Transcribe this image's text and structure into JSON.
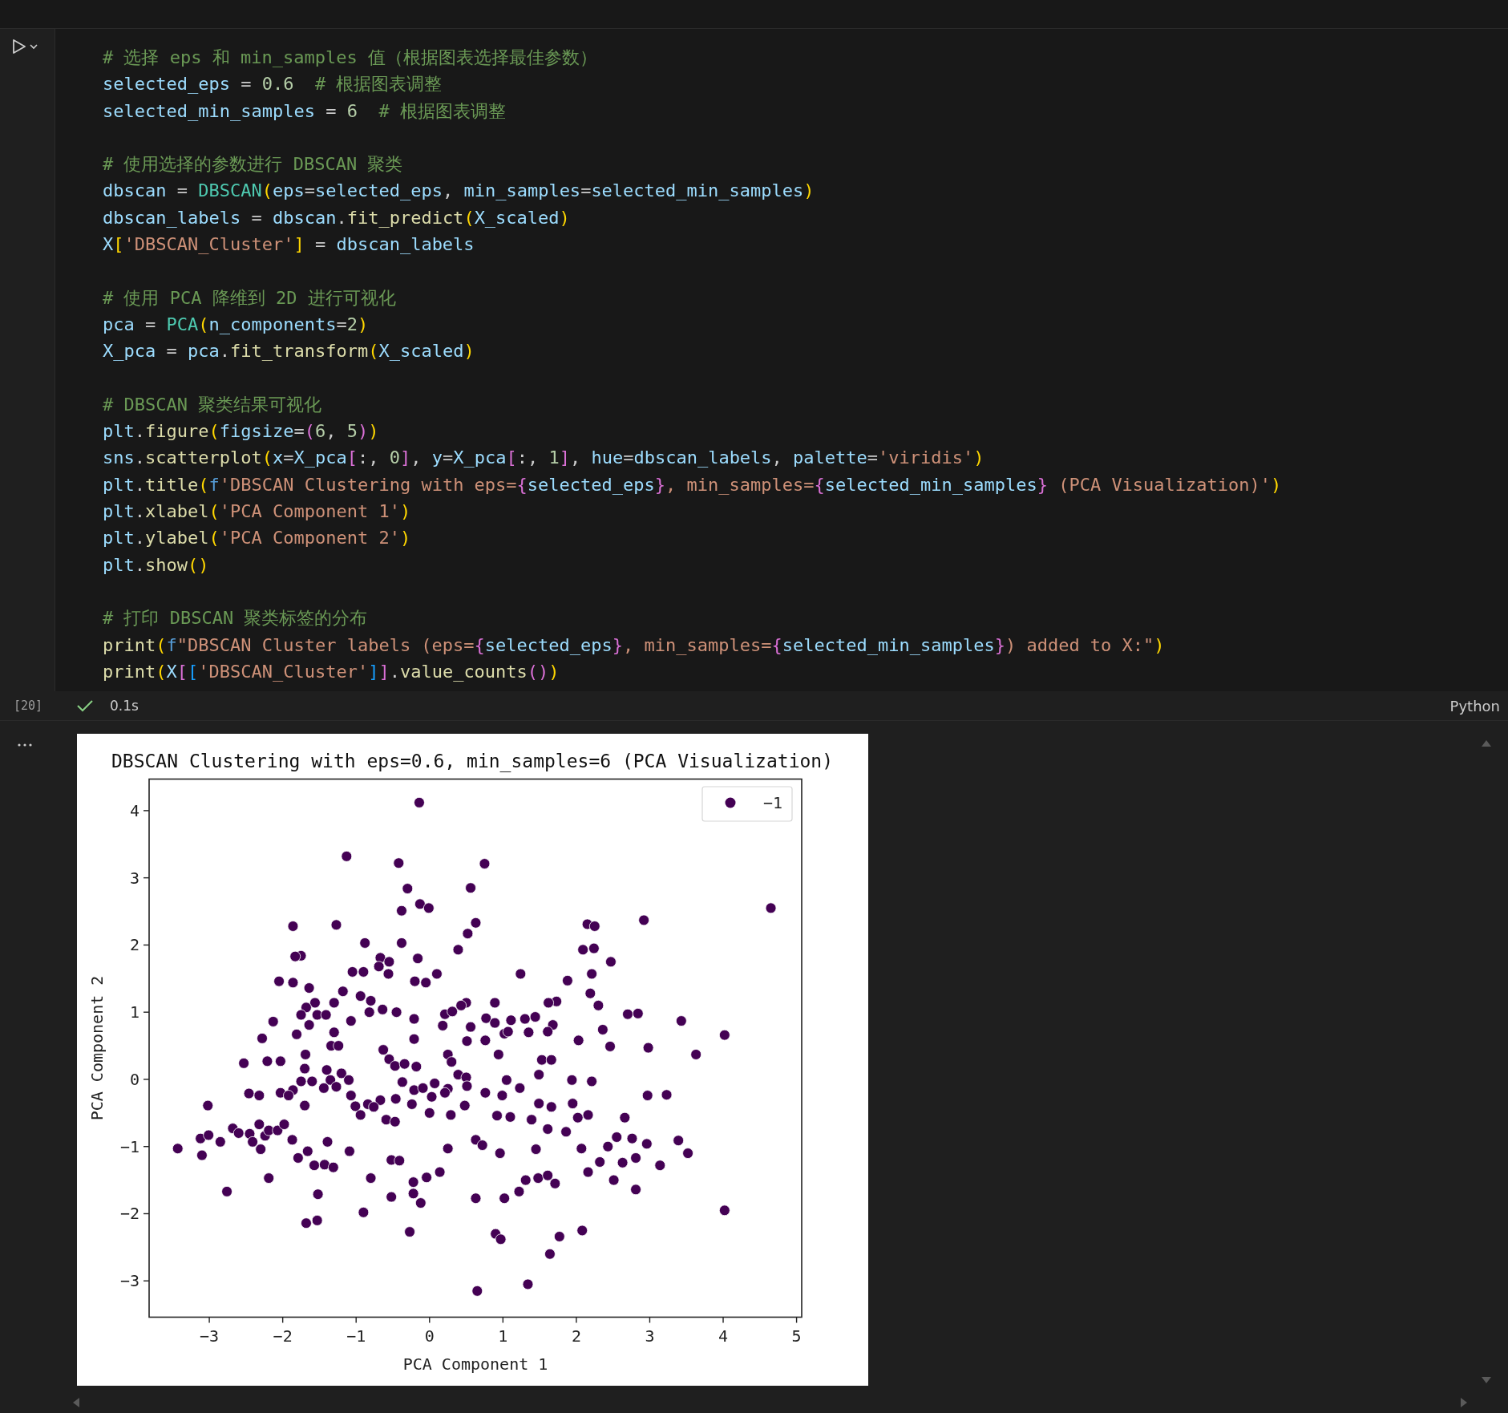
{
  "code_blocks": [
    [
      {
        "tokens": [
          {
            "kind": "comment",
            "text": "# 选择 eps 和 min_samples 值（根据图表选择最佳参数）"
          }
        ]
      },
      {
        "tokens": [
          {
            "kind": "var",
            "text": "selected_eps"
          },
          {
            "kind": "op",
            "text": " = "
          },
          {
            "kind": "num",
            "text": "0.6"
          },
          {
            "kind": "comment",
            "text": "# 根据图表调整"
          }
        ]
      },
      {
        "tokens": [
          {
            "kind": "var",
            "text": "selected_min_samples"
          },
          {
            "kind": "op",
            "text": " = "
          },
          {
            "kind": "num",
            "text": "6"
          },
          {
            "kind": "comment",
            "text": "# 根据图表调整"
          }
        ]
      }
    ],
    [
      {
        "tokens": [
          {
            "kind": "comment",
            "text": "# 使用选择的参数进行 DBSCAN 聚类"
          }
        ]
      },
      {
        "tokens": [
          {
            "kind": "var",
            "text": "dbscan"
          },
          {
            "kind": "op",
            "text": " = "
          },
          {
            "kind": "cls",
            "text": "DBSCAN"
          },
          {
            "kind": "b1",
            "text": "("
          },
          {
            "kind": "var",
            "text": "eps"
          },
          {
            "kind": "op",
            "text": "="
          },
          {
            "kind": "var",
            "text": "selected_eps"
          },
          {
            "kind": "op",
            "text": ", "
          },
          {
            "kind": "var",
            "text": "min_samples"
          },
          {
            "kind": "op",
            "text": "="
          },
          {
            "kind": "var",
            "text": "selected_min_samples"
          },
          {
            "kind": "b1",
            "text": ")"
          }
        ]
      },
      {
        "tokens": [
          {
            "kind": "var",
            "text": "dbscan_labels"
          },
          {
            "kind": "op",
            "text": " = "
          },
          {
            "kind": "var",
            "text": "dbscan"
          },
          {
            "kind": "op",
            "text": "."
          },
          {
            "kind": "fn",
            "text": "fit_predict"
          },
          {
            "kind": "b1",
            "text": "("
          },
          {
            "kind": "var",
            "text": "X_scaled"
          },
          {
            "kind": "b1",
            "text": ")"
          }
        ]
      },
      {
        "tokens": [
          {
            "kind": "var",
            "text": "X"
          },
          {
            "kind": "b1",
            "text": "["
          },
          {
            "kind": "str",
            "text": "'DBSCAN_Cluster'"
          },
          {
            "kind": "b1",
            "text": "]"
          },
          {
            "kind": "op",
            "text": " = "
          },
          {
            "kind": "var",
            "text": "dbscan_labels"
          }
        ]
      }
    ],
    [
      {
        "tokens": [
          {
            "kind": "comment",
            "text": "# 使用 PCA 降维到 2D 进行可视化"
          }
        ]
      },
      {
        "tokens": [
          {
            "kind": "var",
            "text": "pca"
          },
          {
            "kind": "op",
            "text": " = "
          },
          {
            "kind": "cls",
            "text": "PCA"
          },
          {
            "kind": "b1",
            "text": "("
          },
          {
            "kind": "var",
            "text": "n_components"
          },
          {
            "kind": "op",
            "text": "="
          },
          {
            "kind": "num",
            "text": "2"
          },
          {
            "kind": "b1",
            "text": ")"
          }
        ]
      },
      {
        "tokens": [
          {
            "kind": "var",
            "text": "X_pca"
          },
          {
            "kind": "op",
            "text": " = "
          },
          {
            "kind": "var",
            "text": "pca"
          },
          {
            "kind": "op",
            "text": "."
          },
          {
            "kind": "fn",
            "text": "fit_transform"
          },
          {
            "kind": "b1",
            "text": "("
          },
          {
            "kind": "var",
            "text": "X_scaled"
          },
          {
            "kind": "b1",
            "text": ")"
          }
        ]
      }
    ],
    [
      {
        "tokens": [
          {
            "kind": "comment",
            "text": "# DBSCAN 聚类结果可视化"
          }
        ]
      },
      {
        "tokens": [
          {
            "kind": "var",
            "text": "plt"
          },
          {
            "kind": "op",
            "text": "."
          },
          {
            "kind": "fn",
            "text": "figure"
          },
          {
            "kind": "b1",
            "text": "("
          },
          {
            "kind": "var",
            "text": "figsize"
          },
          {
            "kind": "op",
            "text": "="
          },
          {
            "kind": "b2",
            "text": "("
          },
          {
            "kind": "num",
            "text": "6"
          },
          {
            "kind": "op",
            "text": ", "
          },
          {
            "kind": "num",
            "text": "5"
          },
          {
            "kind": "b2",
            "text": ")"
          },
          {
            "kind": "b1",
            "text": ")"
          }
        ]
      },
      {
        "tokens": [
          {
            "kind": "var",
            "text": "sns"
          },
          {
            "kind": "op",
            "text": "."
          },
          {
            "kind": "fn",
            "text": "scatterplot"
          },
          {
            "kind": "b1",
            "text": "("
          },
          {
            "kind": "var",
            "text": "x"
          },
          {
            "kind": "op",
            "text": "="
          },
          {
            "kind": "var",
            "text": "X_pca"
          },
          {
            "kind": "b2",
            "text": "["
          },
          {
            "kind": "op",
            "text": ":, "
          },
          {
            "kind": "num",
            "text": "0"
          },
          {
            "kind": "b2",
            "text": "]"
          },
          {
            "kind": "op",
            "text": ", "
          },
          {
            "kind": "var",
            "text": "y"
          },
          {
            "kind": "op",
            "text": "="
          },
          {
            "kind": "var",
            "text": "X_pca"
          },
          {
            "kind": "b2",
            "text": "["
          },
          {
            "kind": "op",
            "text": ":, "
          },
          {
            "kind": "num",
            "text": "1"
          },
          {
            "kind": "b2",
            "text": "]"
          },
          {
            "kind": "op",
            "text": ", "
          },
          {
            "kind": "var",
            "text": "hue"
          },
          {
            "kind": "op",
            "text": "="
          },
          {
            "kind": "var",
            "text": "dbscan_labels"
          },
          {
            "kind": "op",
            "text": ", "
          },
          {
            "kind": "var",
            "text": "palette"
          },
          {
            "kind": "op",
            "text": "="
          },
          {
            "kind": "str",
            "text": "'viridis'"
          },
          {
            "kind": "b1",
            "text": ")"
          }
        ]
      },
      {
        "tokens": [
          {
            "kind": "var",
            "text": "plt"
          },
          {
            "kind": "op",
            "text": "."
          },
          {
            "kind": "fn",
            "text": "title"
          },
          {
            "kind": "b1",
            "text": "("
          },
          {
            "kind": "kw",
            "text": "f"
          },
          {
            "kind": "str",
            "text": "'DBSCAN Clustering with eps="
          },
          {
            "kind": "b2",
            "text": "{"
          },
          {
            "kind": "var",
            "text": "selected_eps"
          },
          {
            "kind": "b2",
            "text": "}"
          },
          {
            "kind": "str",
            "text": ", min_samples="
          },
          {
            "kind": "b2",
            "text": "{"
          },
          {
            "kind": "var",
            "text": "selected_min_samples"
          },
          {
            "kind": "b2",
            "text": "}"
          },
          {
            "kind": "str",
            "text": " (PCA Visualization)'"
          },
          {
            "kind": "b1",
            "text": ")"
          }
        ]
      },
      {
        "tokens": [
          {
            "kind": "var",
            "text": "plt"
          },
          {
            "kind": "op",
            "text": "."
          },
          {
            "kind": "fn",
            "text": "xlabel"
          },
          {
            "kind": "b1",
            "text": "("
          },
          {
            "kind": "str",
            "text": "'PCA Component 1'"
          },
          {
            "kind": "b1",
            "text": ")"
          }
        ]
      },
      {
        "tokens": [
          {
            "kind": "var",
            "text": "plt"
          },
          {
            "kind": "op",
            "text": "."
          },
          {
            "kind": "fn",
            "text": "ylabel"
          },
          {
            "kind": "b1",
            "text": "("
          },
          {
            "kind": "str",
            "text": "'PCA Component 2'"
          },
          {
            "kind": "b1",
            "text": ")"
          }
        ]
      },
      {
        "tokens": [
          {
            "kind": "var",
            "text": "plt"
          },
          {
            "kind": "op",
            "text": "."
          },
          {
            "kind": "fn",
            "text": "show"
          },
          {
            "kind": "b1",
            "text": "("
          },
          {
            "kind": "b1",
            "text": ")"
          }
        ]
      }
    ],
    [
      {
        "tokens": [
          {
            "kind": "comment",
            "text": "# 打印 DBSCAN 聚类标签的分布"
          }
        ]
      },
      {
        "tokens": [
          {
            "kind": "fn",
            "text": "print"
          },
          {
            "kind": "b1",
            "text": "("
          },
          {
            "kind": "kw",
            "text": "f"
          },
          {
            "kind": "str",
            "text": "\"DBSCAN Cluster labels (eps="
          },
          {
            "kind": "b2",
            "text": "{"
          },
          {
            "kind": "var",
            "text": "selected_eps"
          },
          {
            "kind": "b2",
            "text": "}"
          },
          {
            "kind": "str",
            "text": ", min_samples="
          },
          {
            "kind": "b2",
            "text": "{"
          },
          {
            "kind": "var",
            "text": "selected_min_samples"
          },
          {
            "kind": "b2",
            "text": "}"
          },
          {
            "kind": "str",
            "text": ") added to X:\""
          },
          {
            "kind": "b1",
            "text": ")"
          }
        ]
      },
      {
        "tokens": [
          {
            "kind": "fn",
            "text": "print"
          },
          {
            "kind": "b1",
            "text": "("
          },
          {
            "kind": "var",
            "text": "X"
          },
          {
            "kind": "b2",
            "text": "["
          },
          {
            "kind": "b3",
            "text": "["
          },
          {
            "kind": "str",
            "text": "'DBSCAN_Cluster'"
          },
          {
            "kind": "b3",
            "text": "]"
          },
          {
            "kind": "b2",
            "text": "]"
          },
          {
            "kind": "op",
            "text": "."
          },
          {
            "kind": "fn",
            "text": "value_counts"
          },
          {
            "kind": "b2",
            "text": "("
          },
          {
            "kind": "b2",
            "text": ")"
          },
          {
            "kind": "b1",
            "text": ")"
          }
        ]
      }
    ]
  ],
  "execution_count": "[20]",
  "status": {
    "succeeded": true,
    "duration": "0.1s"
  },
  "language": "Python",
  "output": {
    "chart_data": {
      "type": "scatter",
      "title": "DBSCAN Clustering with eps=0.6, min_samples=6 (PCA Visualization)",
      "xlabel": "PCA Component 1",
      "ylabel": "PCA Component 2",
      "xlim": [
        -3.82,
        5.07
      ],
      "ylim": [
        -3.54,
        4.47
      ],
      "xticks": [
        {
          "value": -3,
          "label": "−3"
        },
        {
          "value": -2,
          "label": "−2"
        },
        {
          "value": -1,
          "label": "−1"
        },
        0,
        1,
        2,
        3,
        4,
        5
      ],
      "yticks": [
        {
          "value": -3,
          "label": "−3"
        },
        {
          "value": -2,
          "label": "−2"
        },
        {
          "value": -1,
          "label": "−1"
        },
        0,
        1,
        2,
        3,
        4
      ],
      "x": [
        -0.14,
        -1.13,
        -0.42,
        0.75,
        -0.3,
        0.56,
        -0.13,
        -0.01,
        -0.38,
        2.92,
        4.65,
        -1.86,
        -1.27,
        0.63,
        0.52,
        -0.88,
        -0.38,
        2.15,
        2.25,
        0.39,
        2.09,
        2.24,
        2.47,
        -1.75,
        -1.83,
        -0.16,
        -0.67,
        -0.55,
        -0.69,
        -1.05,
        -0.9,
        1.24,
        0.1,
        2.21,
        1.88,
        -2.05,
        -1.86,
        -0.2,
        -0.05,
        -0.56,
        -1.64,
        -1.18,
        0.5,
        0.43,
        0.89,
        1.73,
        1.62,
        2.19,
        2.3,
        -1.56,
        -1.3,
        -1.68,
        -0.94,
        -0.8,
        -0.82,
        -0.64,
        -0.45,
        0.21,
        0.31,
        0.77,
        1.11,
        1.3,
        1.44,
        1.68,
        2.7,
        2.84,
        3.43,
        -2.13,
        -1.75,
        -1.53,
        -1.41,
        -1.07,
        -0.21,
        0.18,
        0.56,
        0.89,
        1.35,
        1.02,
        1.61,
        2.03,
        2.36,
        -2.28,
        -1.81,
        -1.64,
        -1.3,
        -1.34,
        -1.24,
        -0.21,
        0.51,
        0.76,
        1.07,
        2.46,
        2.98,
        4.02,
        3.63,
        -2.53,
        -2.21,
        -2.03,
        -1.69,
        -1.7,
        -0.63,
        -0.55,
        -0.47,
        -0.34,
        -0.18,
        0.25,
        0.3,
        0.94,
        1.53,
        1.66,
        -1.75,
        -1.6,
        -1.86,
        -1.4,
        -1.2,
        -1.35,
        -1.1,
        -0.37,
        -0.21,
        -0.09,
        0.07,
        0.25,
        0.39,
        0.5,
        1.05,
        1.49,
        1.94,
        2.21,
        -3.02,
        -2.46,
        -2.03,
        -1.92,
        -2.32,
        -1.44,
        -1.27,
        -1.7,
        -1.07,
        -1.01,
        -0.84,
        -0.67,
        -0.46,
        -0.24,
        0.03,
        0.21,
        0.51,
        0.76,
        0.99,
        1.23,
        1.49,
        1.66,
        1.95,
        2.16,
        2.66,
        2.97,
        3.23,
        -3.43,
        -3.12,
        -3.01,
        -2.85,
        -2.68,
        -2.6,
        -2.45,
        -2.32,
        -2.24,
        -2.19,
        -2.07,
        -1.98,
        -2.41,
        -1.87,
        -2.3,
        -1.79,
        -1.66,
        -1.57,
        -1.39,
        -1.43,
        -1.31,
        -1.09,
        -0.94,
        -0.76,
        -0.59,
        -0.47,
        0.0,
        0.29,
        0.48,
        0.63,
        0.92,
        1.1,
        1.39,
        1.61,
        1.86,
        2.02,
        2.07,
        2.43,
        2.55,
        2.76,
        2.96,
        3.39,
        3.52,
        -3.1,
        -2.19,
        -2.76,
        -0.8,
        -0.52,
        -0.41,
        -0.22,
        -0.04,
        0.14,
        0.25,
        0.72,
        0.96,
        1.45,
        2.16,
        2.32,
        2.51,
        2.63,
        2.81,
        3.14,
        2.81,
        -1.52,
        -0.52,
        -0.22,
        -0.12,
        0.63,
        1.02,
        1.22,
        1.31,
        1.48,
        1.61,
        1.71,
        -1.68,
        -1.53,
        -0.9,
        -0.27,
        0.9,
        0.97,
        1.64,
        1.77,
        2.08,
        4.02,
        0.65,
        1.34
      ],
      "series": [
        {
          "name": "−1",
          "color": "#440154",
          "values": [
            4.12,
            3.32,
            3.22,
            3.21,
            2.84,
            2.85,
            2.61,
            2.55,
            2.51,
            2.37,
            2.55,
            2.28,
            2.3,
            2.33,
            2.17,
            2.03,
            2.03,
            2.31,
            2.28,
            1.93,
            1.93,
            1.95,
            1.75,
            1.84,
            1.83,
            1.8,
            1.81,
            1.75,
            1.68,
            1.6,
            1.6,
            1.57,
            1.57,
            1.57,
            1.47,
            1.46,
            1.44,
            1.46,
            1.44,
            1.57,
            1.36,
            1.31,
            1.14,
            1.1,
            1.14,
            1.16,
            1.14,
            1.28,
            1.1,
            1.14,
            1.14,
            1.07,
            1.24,
            1.17,
            1.0,
            1.04,
            1.0,
            0.97,
            1.01,
            0.91,
            0.88,
            0.9,
            0.93,
            0.81,
            0.97,
            0.98,
            0.87,
            0.86,
            0.96,
            0.96,
            0.96,
            0.87,
            0.9,
            0.8,
            0.78,
            0.84,
            0.7,
            0.68,
            0.71,
            0.58,
            0.74,
            0.61,
            0.67,
            0.81,
            0.7,
            0.5,
            0.5,
            0.6,
            0.57,
            0.58,
            0.71,
            0.49,
            0.47,
            0.66,
            0.37,
            0.24,
            0.27,
            0.27,
            0.37,
            0.16,
            0.44,
            0.3,
            0.2,
            0.23,
            0.19,
            0.37,
            0.26,
            0.37,
            0.29,
            0.29,
            -0.03,
            -0.03,
            -0.16,
            0.14,
            0.09,
            -0.01,
            -0.01,
            -0.04,
            -0.16,
            -0.13,
            -0.06,
            -0.14,
            0.07,
            0.03,
            -0.01,
            0.07,
            -0.01,
            -0.03,
            -0.39,
            -0.21,
            -0.2,
            -0.24,
            -0.24,
            -0.13,
            -0.11,
            -0.39,
            -0.24,
            -0.4,
            -0.37,
            -0.31,
            -0.29,
            -0.37,
            -0.26,
            -0.2,
            -0.1,
            -0.2,
            -0.24,
            -0.13,
            -0.36,
            -0.41,
            -0.36,
            -0.53,
            -0.57,
            -0.24,
            -0.23,
            -1.03,
            -0.88,
            -0.83,
            -0.93,
            -0.73,
            -0.8,
            -0.81,
            -0.67,
            -0.84,
            -0.76,
            -0.76,
            -0.67,
            -0.93,
            -0.9,
            -1.04,
            -1.17,
            -1.07,
            -1.28,
            -0.93,
            -1.27,
            -1.31,
            -1.07,
            -0.53,
            -0.41,
            -0.6,
            -0.63,
            -0.5,
            -0.53,
            -0.39,
            -0.9,
            -0.54,
            -0.56,
            -0.6,
            -0.74,
            -0.78,
            -0.57,
            -1.03,
            -1.0,
            -0.86,
            -0.88,
            -0.96,
            -0.91,
            -1.1,
            -1.13,
            -1.47,
            -1.67,
            -1.47,
            -1.2,
            -1.21,
            -1.53,
            -1.46,
            -1.38,
            -1.03,
            -0.98,
            -1.1,
            -1.04,
            -1.38,
            -1.23,
            -1.5,
            -1.24,
            -1.17,
            -1.28,
            -1.64,
            -1.71,
            -1.75,
            -1.7,
            -1.84,
            -1.77,
            -1.77,
            -1.67,
            -1.5,
            -1.47,
            -1.43,
            -1.55,
            -2.14,
            -2.1,
            -1.98,
            -2.27,
            -2.3,
            -2.38,
            -2.6,
            -2.34,
            -2.25,
            -1.95,
            -3.15,
            -3.05
          ]
        }
      ]
    }
  }
}
